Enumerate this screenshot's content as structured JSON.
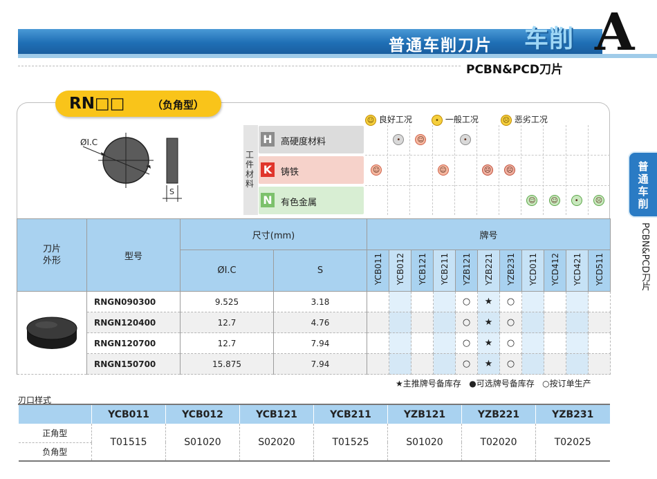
{
  "header": {
    "title": "普通车削刀片",
    "category": "车削",
    "letter": "A",
    "subtitle": "PCBN&PCD刀片",
    "colors": {
      "bar": "#1f6fb5",
      "strip": "#9fcbe9",
      "tag": "#f9c41a"
    }
  },
  "side_tab": {
    "label": "普通车削",
    "sub": "PCBN&PCD刀片"
  },
  "insert": {
    "code": "RN□□",
    "type": "（负角型）",
    "ic_label": "ØI.C",
    "s_label": "S"
  },
  "legend": {
    "good": "良好工况",
    "normal": "一般工况",
    "bad": "恶劣工况"
  },
  "materials": {
    "header": "工件材料",
    "rows": [
      {
        "letter": "H",
        "name": "高硬度材料",
        "color": "#8c8c8c",
        "bg": "#dcdcdc",
        "marks": [
          "",
          "normal",
          "good",
          "",
          "normal",
          "",
          "",
          "",
          "",
          "",
          ""
        ]
      },
      {
        "letter": "K",
        "name": "铸铁",
        "color": "#e0352b",
        "bg": "#f6d2ca",
        "marks": [
          "good",
          "",
          "",
          "good",
          "",
          "bad",
          "bad",
          "",
          "",
          "",
          ""
        ]
      },
      {
        "letter": "N",
        "name": "有色金属",
        "color": "#7cc16b",
        "bg": "#d8eed3",
        "marks": [
          "",
          "",
          "",
          "",
          "",
          "",
          "",
          "good",
          "good",
          "normal",
          "bad"
        ]
      }
    ]
  },
  "table": {
    "col_shape": "刀片\n外形",
    "col_model": "型号",
    "col_size": "尺寸(mm)",
    "col_ic": "ØI.C",
    "col_s": "S",
    "col_grade": "牌号",
    "grades": [
      "YCB011",
      "YCB012",
      "YCB121",
      "YCB211",
      "YZB121",
      "YZB221",
      "YZB231",
      "YCD011",
      "YCD412",
      "YCD421",
      "YCD511"
    ],
    "rows": [
      {
        "model": "RNGN090300",
        "ic": "9.525",
        "s": "3.18",
        "marks": [
          "",
          "",
          "",
          "",
          "○",
          "★",
          "○",
          "",
          "",
          "",
          ""
        ]
      },
      {
        "model": "RNGN120400",
        "ic": "12.7",
        "s": "4.76",
        "marks": [
          "",
          "",
          "",
          "",
          "○",
          "★",
          "○",
          "",
          "",
          "",
          ""
        ]
      },
      {
        "model": "RNGN120700",
        "ic": "12.7",
        "s": "7.94",
        "marks": [
          "",
          "",
          "",
          "",
          "○",
          "★",
          "○",
          "",
          "",
          "",
          ""
        ]
      },
      {
        "model": "RNGN150700",
        "ic": "15.875",
        "s": "7.94",
        "marks": [
          "",
          "",
          "",
          "",
          "○",
          "★",
          "○",
          "",
          "",
          "",
          ""
        ]
      }
    ]
  },
  "notes": {
    "star": "★主推牌号备库存",
    "dot": "●可选牌号备库存",
    "circle": "○按订单生产"
  },
  "edge": {
    "title": "刃口样式",
    "grades": [
      "YCB011",
      "YCB012",
      "YCB121",
      "YCB211",
      "YZB121",
      "YZB221",
      "YZB231"
    ],
    "row_labels": [
      "正角型",
      "负角型"
    ],
    "values": [
      "T01515",
      "S01020",
      "S02020",
      "T01525",
      "S01020",
      "T02020",
      "T02025"
    ]
  }
}
